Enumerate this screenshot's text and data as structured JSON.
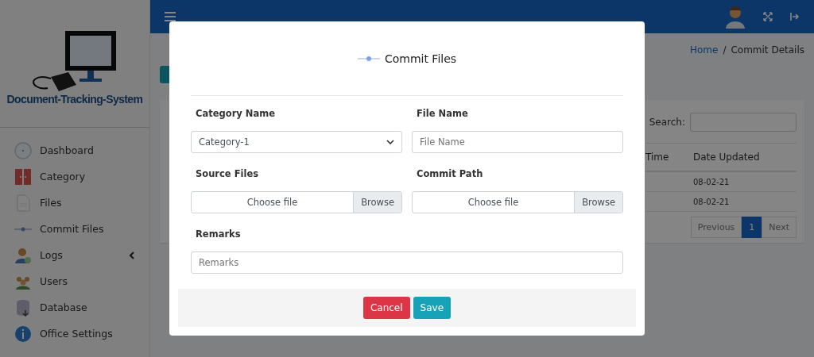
{
  "sidebar": {
    "logo_text": "Document-Tracking-System",
    "items": [
      {
        "label": "Dashboard",
        "kind": "dashboard",
        "has_submenu": false
      },
      {
        "label": "Category",
        "kind": "category",
        "has_submenu": false
      },
      {
        "label": "Files",
        "kind": "files",
        "has_submenu": false
      },
      {
        "label": "Commit Files",
        "kind": "commit",
        "has_submenu": false
      },
      {
        "label": "Logs",
        "kind": "logs",
        "has_submenu": true
      },
      {
        "label": "Users",
        "kind": "users",
        "has_submenu": false
      },
      {
        "label": "Database",
        "kind": "database",
        "has_submenu": false
      },
      {
        "label": "Office Settings",
        "kind": "settings",
        "has_submenu": false
      }
    ]
  },
  "breadcrumb_separator": "/",
  "breadcrumb": [
    {
      "label": "Home",
      "kind": "link"
    },
    {
      "label": "Commit Details",
      "kind": "current"
    }
  ],
  "table": {
    "search_label": "Search:",
    "columns": [
      "Time",
      "Date Updated"
    ],
    "rows": [
      {
        "date_updated": "08-02-21"
      },
      {
        "date_updated": "08-02-21"
      }
    ],
    "pagination": {
      "previous": "Previous",
      "pages": [
        {
          "label": "1",
          "selected": true
        }
      ],
      "next": "Next"
    }
  },
  "modal": {
    "title": "Commit Files",
    "fields": [
      {
        "kind": "select",
        "label": "Category Name",
        "value": "Category-1"
      },
      {
        "kind": "text",
        "label": "File Name",
        "placeholder": "File Name"
      },
      {
        "kind": "file",
        "label": "Source Files",
        "value": "Choose file",
        "button": "Browse"
      },
      {
        "kind": "file",
        "label": "Commit Path",
        "value": "Choose file",
        "button": "Browse"
      },
      {
        "kind": "wide",
        "label": "Remarks",
        "placeholder": "Remarks"
      }
    ],
    "buttons": [
      {
        "label": "Cancel",
        "kind": "danger"
      },
      {
        "label": "Save",
        "kind": "primary"
      }
    ]
  }
}
